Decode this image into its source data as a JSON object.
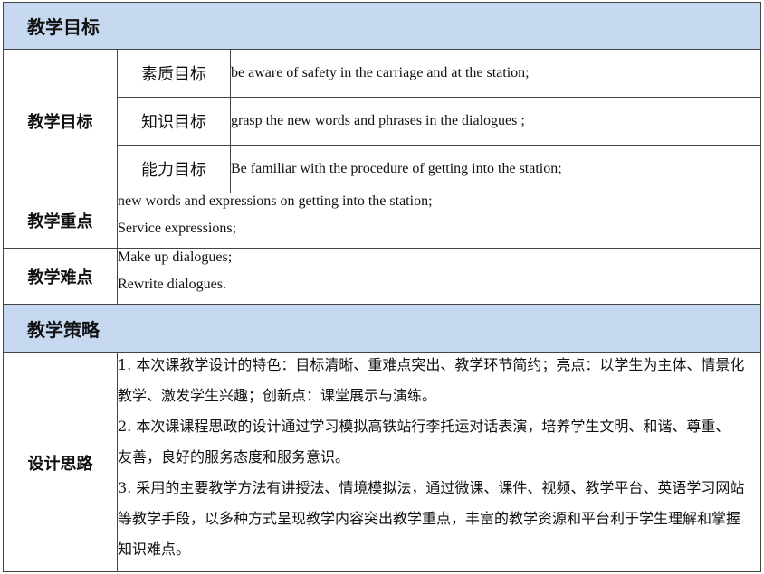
{
  "sections": {
    "objectives_header": "教学目标",
    "strategy_header": "教学策略"
  },
  "objectives": {
    "label": "教学目标",
    "items": [
      {
        "name": "素质目标",
        "text": "be aware of safety in the carriage and at the station;"
      },
      {
        "name": "知识目标",
        "text": "grasp the new words and phrases in the dialogues ;"
      },
      {
        "name": "能力目标",
        "text": "Be familiar with the procedure of getting into the station;"
      }
    ]
  },
  "key_points": {
    "label": "教学重点",
    "lines": [
      "new words and expressions on getting into the station;",
      "Service expressions;"
    ]
  },
  "difficulties": {
    "label": "教学难点",
    "lines": [
      "Make up dialogues;",
      "Rewrite dialogues."
    ]
  },
  "design": {
    "label": "设计思路",
    "lines": [
      "1. 本次课教学设计的特色：目标清晰、重难点突出、教学环节简约；亮点：以学生为主体、情景化",
      "教学、激发学生兴趣；创新点：课堂展示与演练。",
      "2. 本次课课程思政的设计通过学习模拟高铁站行李托运对话表演，培养学生文明、和谐、尊重、",
      "友善，良好的服务态度和服务意识。",
      "3. 采用的主要教学方法有讲授法、情境模拟法，通过微课、课件、视频、教学平台、英语学习网站",
      "等教学手段，以多种方式呈现教学内容突出教学重点，丰富的教学资源和平台利于学生理解和掌握",
      "知识难点。"
    ]
  }
}
